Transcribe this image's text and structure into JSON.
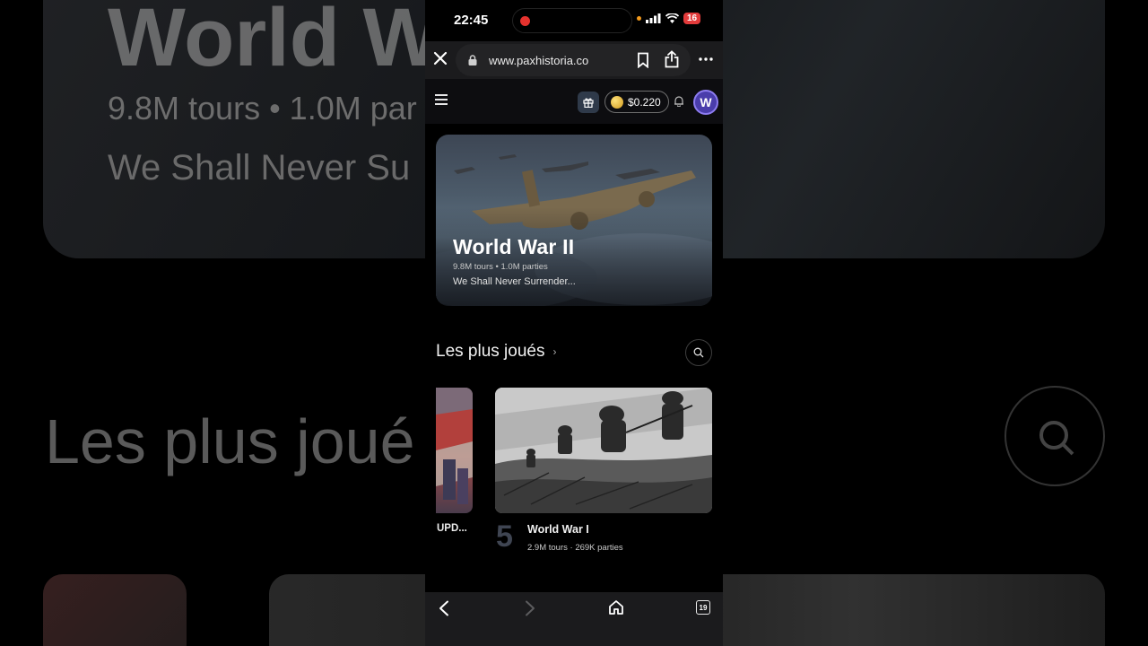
{
  "background": {
    "title": "World W",
    "stats": "9.8M tours • 1.0M par",
    "desc": "We Shall Never Su",
    "section": "Les plus joué"
  },
  "status_bar": {
    "time": "22:45",
    "battery": "16"
  },
  "browser": {
    "url": "www.paxhistoria.co",
    "tab_count": "19"
  },
  "header": {
    "balance": "$0.220",
    "avatar_letter": "W"
  },
  "hero": {
    "title": "World War II",
    "stats": "9.8M tours • 1.0M parties",
    "description": "We Shall Never Surrender..."
  },
  "section": {
    "title": "Les plus joués",
    "chevron": "›"
  },
  "cards": [
    {
      "title": "UPD..."
    },
    {
      "rank": "5",
      "title": "World War I",
      "stats": "2.9M tours · 269K parties"
    }
  ],
  "colors": {
    "accent_avatar": "#4a3dab",
    "record_dot": "#e5322e",
    "battery_red": "#e23b3b"
  }
}
